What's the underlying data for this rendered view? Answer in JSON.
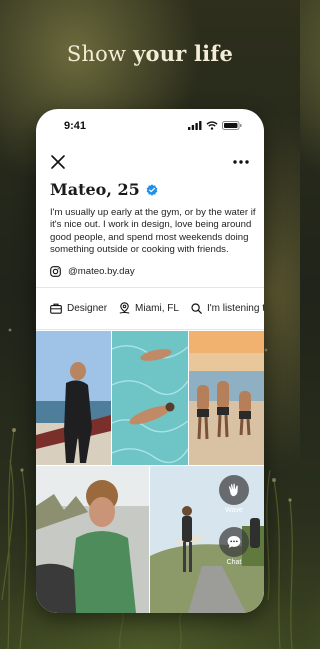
{
  "headline": {
    "prefix": "Show ",
    "bold": "your life"
  },
  "status_bar": {
    "time": "9:41"
  },
  "profile": {
    "name": "Mateo, 25",
    "bio": "I'm usually up early at the gym, or by the water if it's nice out. I work in design, love being around good people, and spend most weekends doing something outside or cooking with friends.",
    "instagram": "@mateo.by.day",
    "tags": [
      {
        "icon": "briefcase-icon",
        "label": "Designer"
      },
      {
        "icon": "location-pin-icon",
        "label": "Miami, FL"
      },
      {
        "icon": "search-icon",
        "label": "I'm listening to"
      }
    ]
  },
  "actions": {
    "wave_label": "Wave",
    "chat_label": "Chat"
  },
  "colors": {
    "verified": "#1d8ff0",
    "headline": "#f3ecd6",
    "fab": "#3c3c3c"
  }
}
